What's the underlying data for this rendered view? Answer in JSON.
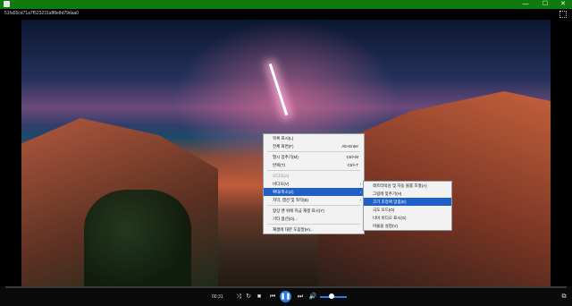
{
  "window": {
    "minimize": "—",
    "maximize": "☐",
    "close": "✕",
    "filename": "51fa55cd71a7f523231aff8e8d79daa0"
  },
  "player": {
    "time": "00:31",
    "progress_fraction": 0.0,
    "accent": "#2c7be5",
    "titlebar_color": "#0f7b0f"
  },
  "context_menu": {
    "items": [
      {
        "label": "목록 표시(L)",
        "shortcut": "",
        "arrow": "",
        "state": "normal"
      },
      {
        "label": "전체 화면(F)",
        "shortcut": "Alt+Enter",
        "arrow": "",
        "state": "normal"
      },
      {
        "label": "열시 멈추기(M)",
        "shortcut": "Ctrl+M",
        "arrow": "",
        "state": "normal"
      },
      {
        "label": "반복(T)",
        "shortcut": "Ctrl+T",
        "arrow": "",
        "state": "normal"
      },
      {
        "label": "오디오(A)",
        "shortcut": "",
        "arrow": "",
        "state": "disabled"
      },
      {
        "label": "비디오(V)",
        "shortcut": "",
        "arrow": "›",
        "state": "normal"
      },
      {
        "label": "확대/축소(Z)",
        "shortcut": "",
        "arrow": "›",
        "state": "highlighted"
      },
      {
        "label": "자막, 캡션 및 자막(B)",
        "shortcut": "",
        "arrow": "›",
        "state": "normal"
      },
      {
        "label": "항상 맨 위에 지금 재생 표시(Y)",
        "shortcut": "",
        "arrow": "",
        "state": "normal"
      },
      {
        "label": "기타 옵션(O)...",
        "shortcut": "",
        "arrow": "",
        "state": "normal"
      },
      {
        "label": "재생에 대한 도움말(H)...",
        "shortcut": "",
        "arrow": "",
        "state": "normal"
      }
    ]
  },
  "submenu": {
    "items": [
      {
        "label": "레트터박싱 및 자동 볼륨 조절(A)",
        "state": "normal"
      },
      {
        "label": "그림에 맞추기(H)",
        "state": "normal"
      },
      {
        "label": "크기 조정에 맞춤(E)",
        "state": "highlighted"
      },
      {
        "label": "극도 모드(O)",
        "state": "normal"
      },
      {
        "label": "너비 비디오 표시(S)",
        "state": "normal"
      },
      {
        "label": "비율을 설정(V)",
        "state": "normal"
      }
    ]
  }
}
